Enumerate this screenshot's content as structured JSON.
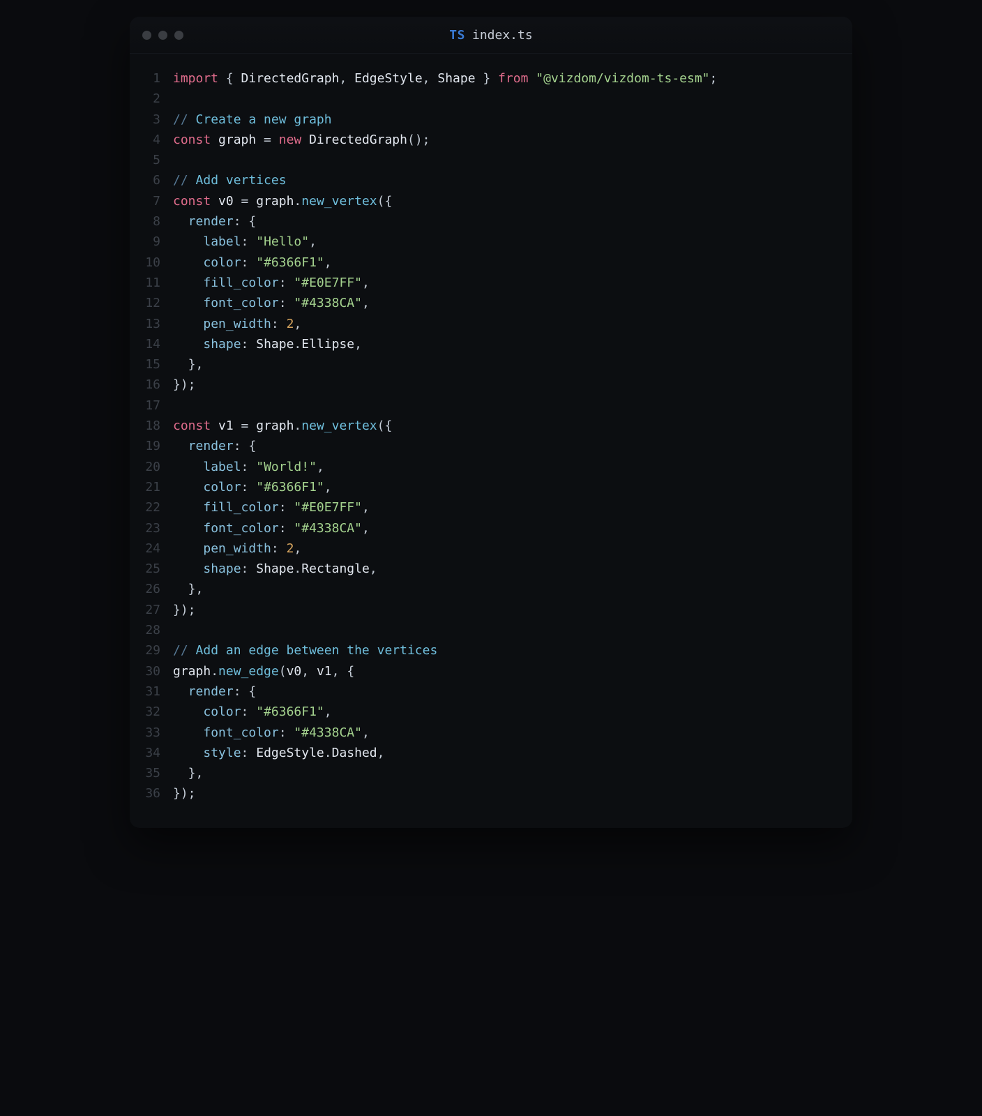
{
  "tab": {
    "language": "TS",
    "filename": "index.ts"
  },
  "line_count": 36,
  "code_lines": [
    {
      "n": 1,
      "t": [
        {
          "c": "kw",
          "v": "import"
        },
        {
          "c": "pu",
          "v": " { "
        },
        {
          "c": "id",
          "v": "DirectedGraph"
        },
        {
          "c": "pu",
          "v": ", "
        },
        {
          "c": "id",
          "v": "EdgeStyle"
        },
        {
          "c": "pu",
          "v": ", "
        },
        {
          "c": "id",
          "v": "Shape"
        },
        {
          "c": "pu",
          "v": " } "
        },
        {
          "c": "kw",
          "v": "from"
        },
        {
          "c": "pu",
          "v": " "
        },
        {
          "c": "str",
          "v": "\"@vizdom/vizdom-ts-esm\""
        },
        {
          "c": "pu",
          "v": ";"
        }
      ]
    },
    {
      "n": 2,
      "t": []
    },
    {
      "n": 3,
      "t": [
        {
          "c": "cm",
          "v": "// "
        },
        {
          "c": "fn",
          "v": "Create a new graph"
        }
      ]
    },
    {
      "n": 4,
      "t": [
        {
          "c": "kw",
          "v": "const"
        },
        {
          "c": "pu",
          "v": " "
        },
        {
          "c": "id",
          "v": "graph"
        },
        {
          "c": "pu",
          "v": " = "
        },
        {
          "c": "kw",
          "v": "new"
        },
        {
          "c": "pu",
          "v": " "
        },
        {
          "c": "ty",
          "v": "DirectedGraph"
        },
        {
          "c": "pu",
          "v": "();"
        }
      ]
    },
    {
      "n": 5,
      "t": []
    },
    {
      "n": 6,
      "t": [
        {
          "c": "cm",
          "v": "// "
        },
        {
          "c": "fn",
          "v": "Add vertices"
        }
      ]
    },
    {
      "n": 7,
      "t": [
        {
          "c": "kw",
          "v": "const"
        },
        {
          "c": "pu",
          "v": " "
        },
        {
          "c": "id",
          "v": "v0"
        },
        {
          "c": "pu",
          "v": " = "
        },
        {
          "c": "id",
          "v": "graph"
        },
        {
          "c": "pu",
          "v": "."
        },
        {
          "c": "fn",
          "v": "new_vertex"
        },
        {
          "c": "pu",
          "v": "({"
        }
      ]
    },
    {
      "n": 8,
      "t": [
        {
          "c": "pu",
          "v": "  "
        },
        {
          "c": "pr",
          "v": "render"
        },
        {
          "c": "pu",
          "v": ": {"
        }
      ]
    },
    {
      "n": 9,
      "t": [
        {
          "c": "pu",
          "v": "    "
        },
        {
          "c": "pr",
          "v": "label"
        },
        {
          "c": "pu",
          "v": ": "
        },
        {
          "c": "str",
          "v": "\"Hello\""
        },
        {
          "c": "pu",
          "v": ","
        }
      ]
    },
    {
      "n": 10,
      "t": [
        {
          "c": "pu",
          "v": "    "
        },
        {
          "c": "pr",
          "v": "color"
        },
        {
          "c": "pu",
          "v": ": "
        },
        {
          "c": "str",
          "v": "\"#6366F1\""
        },
        {
          "c": "pu",
          "v": ","
        }
      ]
    },
    {
      "n": 11,
      "t": [
        {
          "c": "pu",
          "v": "    "
        },
        {
          "c": "pr",
          "v": "fill_color"
        },
        {
          "c": "pu",
          "v": ": "
        },
        {
          "c": "str",
          "v": "\"#E0E7FF\""
        },
        {
          "c": "pu",
          "v": ","
        }
      ]
    },
    {
      "n": 12,
      "t": [
        {
          "c": "pu",
          "v": "    "
        },
        {
          "c": "pr",
          "v": "font_color"
        },
        {
          "c": "pu",
          "v": ": "
        },
        {
          "c": "str",
          "v": "\"#4338CA\""
        },
        {
          "c": "pu",
          "v": ","
        }
      ]
    },
    {
      "n": 13,
      "t": [
        {
          "c": "pu",
          "v": "    "
        },
        {
          "c": "pr",
          "v": "pen_width"
        },
        {
          "c": "pu",
          "v": ": "
        },
        {
          "c": "num",
          "v": "2"
        },
        {
          "c": "pu",
          "v": ","
        }
      ]
    },
    {
      "n": 14,
      "t": [
        {
          "c": "pu",
          "v": "    "
        },
        {
          "c": "pr",
          "v": "shape"
        },
        {
          "c": "pu",
          "v": ": "
        },
        {
          "c": "id",
          "v": "Shape"
        },
        {
          "c": "pu",
          "v": "."
        },
        {
          "c": "id",
          "v": "Ellipse"
        },
        {
          "c": "pu",
          "v": ","
        }
      ]
    },
    {
      "n": 15,
      "t": [
        {
          "c": "pu",
          "v": "  },"
        }
      ]
    },
    {
      "n": 16,
      "t": [
        {
          "c": "pu",
          "v": "});"
        }
      ]
    },
    {
      "n": 17,
      "t": []
    },
    {
      "n": 18,
      "t": [
        {
          "c": "kw",
          "v": "const"
        },
        {
          "c": "pu",
          "v": " "
        },
        {
          "c": "id",
          "v": "v1"
        },
        {
          "c": "pu",
          "v": " = "
        },
        {
          "c": "id",
          "v": "graph"
        },
        {
          "c": "pu",
          "v": "."
        },
        {
          "c": "fn",
          "v": "new_vertex"
        },
        {
          "c": "pu",
          "v": "({"
        }
      ]
    },
    {
      "n": 19,
      "t": [
        {
          "c": "pu",
          "v": "  "
        },
        {
          "c": "pr",
          "v": "render"
        },
        {
          "c": "pu",
          "v": ": {"
        }
      ]
    },
    {
      "n": 20,
      "t": [
        {
          "c": "pu",
          "v": "    "
        },
        {
          "c": "pr",
          "v": "label"
        },
        {
          "c": "pu",
          "v": ": "
        },
        {
          "c": "str",
          "v": "\"World!\""
        },
        {
          "c": "pu",
          "v": ","
        }
      ]
    },
    {
      "n": 21,
      "t": [
        {
          "c": "pu",
          "v": "    "
        },
        {
          "c": "pr",
          "v": "color"
        },
        {
          "c": "pu",
          "v": ": "
        },
        {
          "c": "str",
          "v": "\"#6366F1\""
        },
        {
          "c": "pu",
          "v": ","
        }
      ]
    },
    {
      "n": 22,
      "t": [
        {
          "c": "pu",
          "v": "    "
        },
        {
          "c": "pr",
          "v": "fill_color"
        },
        {
          "c": "pu",
          "v": ": "
        },
        {
          "c": "str",
          "v": "\"#E0E7FF\""
        },
        {
          "c": "pu",
          "v": ","
        }
      ]
    },
    {
      "n": 23,
      "t": [
        {
          "c": "pu",
          "v": "    "
        },
        {
          "c": "pr",
          "v": "font_color"
        },
        {
          "c": "pu",
          "v": ": "
        },
        {
          "c": "str",
          "v": "\"#4338CA\""
        },
        {
          "c": "pu",
          "v": ","
        }
      ]
    },
    {
      "n": 24,
      "t": [
        {
          "c": "pu",
          "v": "    "
        },
        {
          "c": "pr",
          "v": "pen_width"
        },
        {
          "c": "pu",
          "v": ": "
        },
        {
          "c": "num",
          "v": "2"
        },
        {
          "c": "pu",
          "v": ","
        }
      ]
    },
    {
      "n": 25,
      "t": [
        {
          "c": "pu",
          "v": "    "
        },
        {
          "c": "pr",
          "v": "shape"
        },
        {
          "c": "pu",
          "v": ": "
        },
        {
          "c": "id",
          "v": "Shape"
        },
        {
          "c": "pu",
          "v": "."
        },
        {
          "c": "id",
          "v": "Rectangle"
        },
        {
          "c": "pu",
          "v": ","
        }
      ]
    },
    {
      "n": 26,
      "t": [
        {
          "c": "pu",
          "v": "  },"
        }
      ]
    },
    {
      "n": 27,
      "t": [
        {
          "c": "pu",
          "v": "});"
        }
      ]
    },
    {
      "n": 28,
      "t": []
    },
    {
      "n": 29,
      "t": [
        {
          "c": "cm",
          "v": "// "
        },
        {
          "c": "fn",
          "v": "Add an edge between the vertices"
        }
      ]
    },
    {
      "n": 30,
      "t": [
        {
          "c": "id",
          "v": "graph"
        },
        {
          "c": "pu",
          "v": "."
        },
        {
          "c": "fn",
          "v": "new_edge"
        },
        {
          "c": "pu",
          "v": "("
        },
        {
          "c": "id",
          "v": "v0"
        },
        {
          "c": "pu",
          "v": ", "
        },
        {
          "c": "id",
          "v": "v1"
        },
        {
          "c": "pu",
          "v": ", {"
        }
      ]
    },
    {
      "n": 31,
      "t": [
        {
          "c": "pu",
          "v": "  "
        },
        {
          "c": "pr",
          "v": "render"
        },
        {
          "c": "pu",
          "v": ": {"
        }
      ]
    },
    {
      "n": 32,
      "t": [
        {
          "c": "pu",
          "v": "    "
        },
        {
          "c": "pr",
          "v": "color"
        },
        {
          "c": "pu",
          "v": ": "
        },
        {
          "c": "str",
          "v": "\"#6366F1\""
        },
        {
          "c": "pu",
          "v": ","
        }
      ]
    },
    {
      "n": 33,
      "t": [
        {
          "c": "pu",
          "v": "    "
        },
        {
          "c": "pr",
          "v": "font_color"
        },
        {
          "c": "pu",
          "v": ": "
        },
        {
          "c": "str",
          "v": "\"#4338CA\""
        },
        {
          "c": "pu",
          "v": ","
        }
      ]
    },
    {
      "n": 34,
      "t": [
        {
          "c": "pu",
          "v": "    "
        },
        {
          "c": "pr",
          "v": "style"
        },
        {
          "c": "pu",
          "v": ": "
        },
        {
          "c": "id",
          "v": "EdgeStyle"
        },
        {
          "c": "pu",
          "v": "."
        },
        {
          "c": "id",
          "v": "Dashed"
        },
        {
          "c": "pu",
          "v": ","
        }
      ]
    },
    {
      "n": 35,
      "t": [
        {
          "c": "pu",
          "v": "  },"
        }
      ]
    },
    {
      "n": 36,
      "t": [
        {
          "c": "pu",
          "v": "});"
        }
      ]
    }
  ]
}
